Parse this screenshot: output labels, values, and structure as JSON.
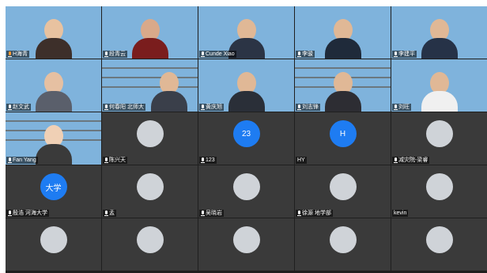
{
  "participants": [
    {
      "name": "H海青",
      "mic": "host"
    },
    {
      "name": "段青云"
    },
    {
      "name": "Cunde Xiao"
    },
    {
      "name": "李骏"
    },
    {
      "name": "李建平"
    },
    {
      "name": "赵文武"
    },
    {
      "name": "何春阳 北师大"
    },
    {
      "name": "黄庆旭"
    },
    {
      "name": "刘志锋"
    },
    {
      "name": "刘旺"
    },
    {
      "name": "Fan Yang"
    },
    {
      "name": "陈兴天"
    },
    {
      "name": "123",
      "avatar_text": "23"
    },
    {
      "name": "HY",
      "avatar_text": "H"
    },
    {
      "name": "减灾院-梁睿"
    },
    {
      "name": "殷浩 河海大学",
      "avatar_text": "大学"
    },
    {
      "name": "孟"
    },
    {
      "name": "吴晓岩"
    },
    {
      "name": "徐源 地学部"
    },
    {
      "name": "kevin"
    },
    {
      "name": ""
    },
    {
      "name": ""
    },
    {
      "name": ""
    },
    {
      "name": ""
    },
    {
      "name": ""
    }
  ],
  "colors": {
    "grid_background": "#1f1f1f",
    "tile_background": "#3a3a3a",
    "avatar_blue": "#1e7cf2",
    "host_mic": "#ff9a2e"
  }
}
